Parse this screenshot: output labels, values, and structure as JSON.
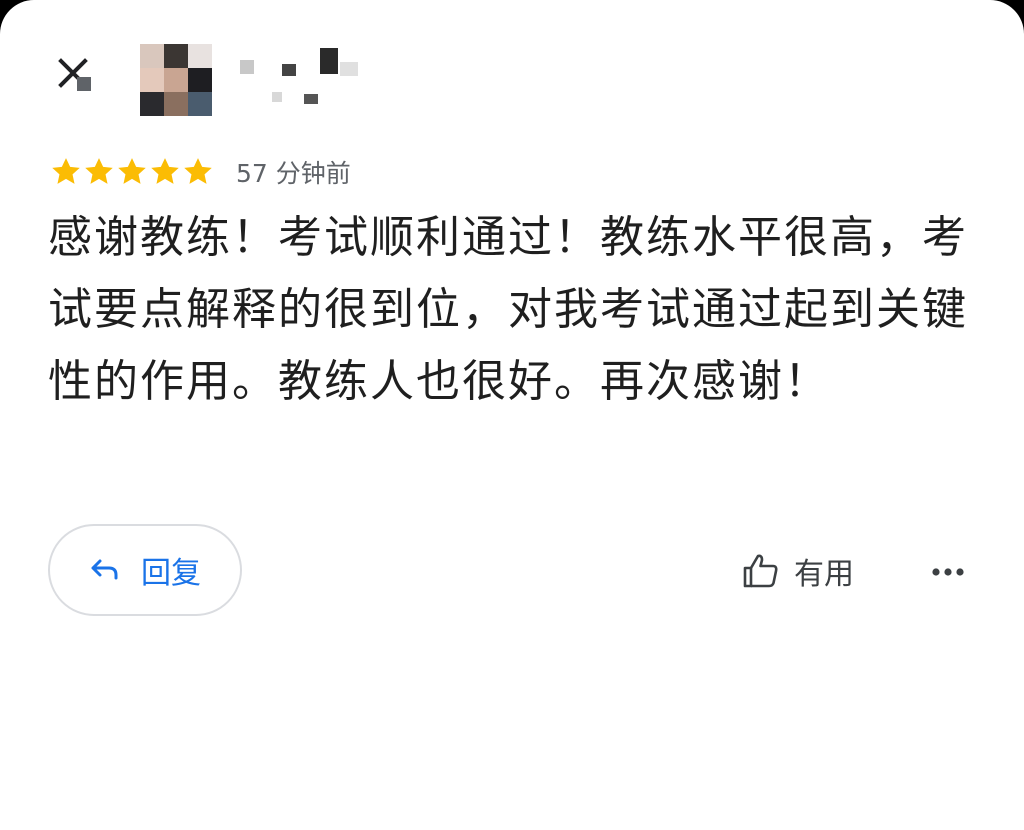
{
  "header": {
    "close_icon": "close-icon",
    "avatar": "pixelated-avatar",
    "reviewer_name": "pixelated-name"
  },
  "review": {
    "rating": 5,
    "rating_max": 5,
    "star_color": "#fbbc04",
    "time_ago": "57 分钟前",
    "text": "感谢教练！考试顺利通过！教练水平很高，考试要点解释的很到位，对我考试通过起到关键性的作用。教练人也很好。再次感谢！"
  },
  "actions": {
    "reply_label": "回复",
    "reply_icon": "reply-arrow-icon",
    "helpful_label": "有用",
    "helpful_icon": "thumb-up-icon",
    "more_icon": "more-horizontal-icon",
    "accent_color": "#1a73e8"
  }
}
